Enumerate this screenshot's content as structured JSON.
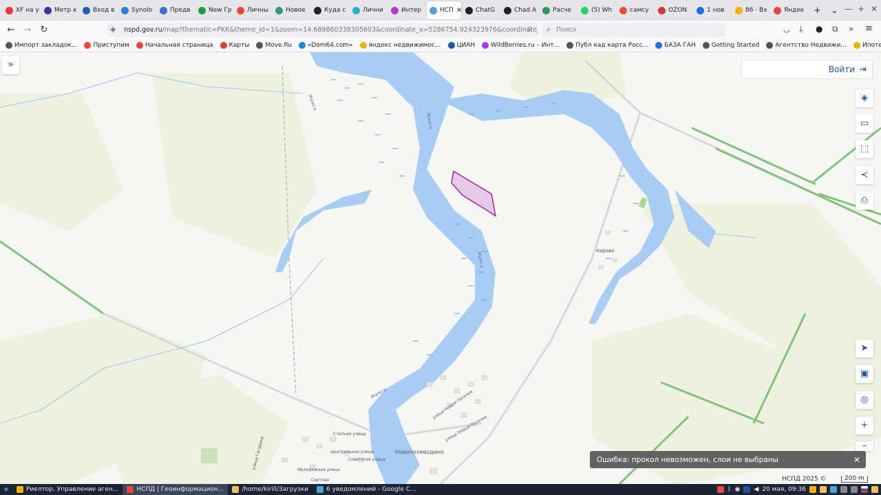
{
  "browser": {
    "tabs": [
      {
        "label": "XF на у",
        "color": "#e53935"
      },
      {
        "label": "Метр к",
        "color": "#4a2ba8"
      },
      {
        "label": "Вход в",
        "color": "#1e5fb4"
      },
      {
        "label": "Synolo",
        "color": "#2a7de1"
      },
      {
        "label": "Предв",
        "color": "#3b6fd6"
      },
      {
        "label": "New Гр",
        "color": "#1a9b4a"
      },
      {
        "label": "Личны",
        "color": "#e8473b"
      },
      {
        "label": "Новое",
        "color": "#2aa06a"
      },
      {
        "label": "Куда с",
        "color": "#222222"
      },
      {
        "label": "Лични",
        "color": "#2bb0c9"
      },
      {
        "label": "Интер",
        "color": "#b23bd6"
      },
      {
        "label": "НСП",
        "color": "#4aa3d8",
        "active": true
      },
      {
        "label": "ChatG",
        "color": "#222222"
      },
      {
        "label": "Chad A",
        "color": "#222222"
      },
      {
        "label": "Расче",
        "color": "#2b9b58"
      },
      {
        "label": "(5) Wh",
        "color": "#25d366"
      },
      {
        "label": "самсу",
        "color": "#e94b3c"
      },
      {
        "label": "OZON",
        "color": "#d8353c"
      },
      {
        "label": "1 нов",
        "color": "#1e6fe0"
      },
      {
        "label": "86 · Вх",
        "color": "#f0b400"
      },
      {
        "label": "Яндек",
        "color": "#e8473b"
      }
    ],
    "new_tab": "+",
    "tab_list": "⌄",
    "url_main": "nspd.gov.ru",
    "url_rest": "/map?thematic=PKK&theme_id=1&zoom=14.689860338305603&coordinate_x=5286754.924323976&coordinate_y=6758206.30319",
    "search_placeholder": "Поиск",
    "bookmarks": [
      {
        "label": "Импорт закладок...",
        "color": "#555555"
      },
      {
        "label": "Приступим",
        "color": "#e8473b"
      },
      {
        "label": "Начальная страница",
        "color": "#e8473b"
      },
      {
        "label": "Карты",
        "color": "#e53935"
      },
      {
        "label": "Move.Ru",
        "color": "#555555"
      },
      {
        "label": "«Dom64.com»",
        "color": "#1e88e5"
      },
      {
        "label": "яндекс недвижимос...",
        "color": "#f0b400"
      },
      {
        "label": "ЦИАН",
        "color": "#1a56a4"
      },
      {
        "label": "WildBerries.ru – Инт...",
        "color": "#b23bd6"
      },
      {
        "label": "Публ кад карта Росс...",
        "color": "#555555"
      },
      {
        "label": "БАЗА ГАН",
        "color": "#1e6fe0"
      },
      {
        "label": "Getting Started",
        "color": "#555555"
      },
      {
        "label": "Агентство Недвижи...",
        "color": "#555555"
      },
      {
        "label": "Ипотечный калькул...",
        "color": "#f0b400"
      }
    ],
    "more_bookmarks": "»",
    "other_bookmarks": "Другие закладки"
  },
  "map": {
    "login_label": "Войти",
    "labels": {
      "river_1": "Жижга",
      "river_2": "Жижга",
      "river_3": "Жижга",
      "river_4": "Жижга",
      "village_1": "Кирово",
      "village_2": "Новополеводино",
      "street_1": "улица Новый Поселок",
      "street_2": "улица Новый Поселок",
      "street_3": "Степная улица",
      "street_4": "Центральная улица",
      "street_5": "Советская улица",
      "street_6": "Молодежная улица",
      "street_7": "улица Гагарина",
      "street_8": "Светлая"
    },
    "toast_text": "Ошибка: прокол невозможен, слои не выбраны",
    "copyright": "НСПД 2025 ©",
    "scale_label": "200 m",
    "colors": {
      "water": "#a8cdf5",
      "parcel": "#e8c8e8",
      "parcel_stroke": "#9b2a9b",
      "field": "#eef1de",
      "accent": "#1a56a4"
    }
  },
  "taskbar": {
    "items": [
      {
        "label": "Риелтор. Управление аген...",
        "color": "#f0b400"
      },
      {
        "label": "НСПД | Геоинформацион...",
        "color": "#e8473b",
        "active": true
      },
      {
        "label": "/home/kirill/Загрузки",
        "color": "#f0c060"
      },
      {
        "label": "6 уведомлений - Google C...",
        "color": "#4aa3d8"
      }
    ],
    "clock": "20 мая, 09:36"
  }
}
